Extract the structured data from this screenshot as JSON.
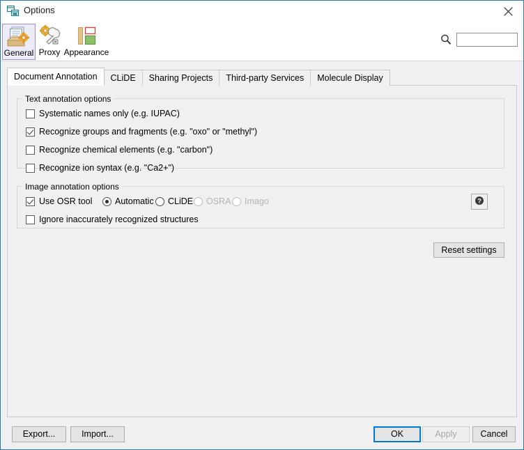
{
  "window": {
    "title": "Options",
    "title_icon": "options-windows-icon",
    "close_icon": "close-icon",
    "accent_border": "#2a7ab0"
  },
  "toolbar": {
    "items": [
      {
        "label": "General",
        "icon": "general-documents-gear-icon",
        "selected": true
      },
      {
        "label": "Proxy",
        "icon": "proxy-gear-wrench-icon",
        "selected": false
      },
      {
        "label": "Appearance",
        "icon": "appearance-layout-icon",
        "selected": false
      }
    ],
    "search": {
      "icon": "search-magnifier-icon",
      "value": "",
      "placeholder": ""
    }
  },
  "tabs": [
    {
      "label": "Document Annotation",
      "active": true
    },
    {
      "label": "CLiDE",
      "active": false
    },
    {
      "label": "Sharing Projects",
      "active": false
    },
    {
      "label": "Third-party Services",
      "active": false
    },
    {
      "label": "Molecule Display",
      "active": false
    }
  ],
  "text_annotation": {
    "title": "Text annotation options",
    "options": [
      {
        "label": "Systematic names only (e.g. IUPAC)",
        "checked": false
      },
      {
        "label": "Recognize groups and fragments (e.g. \"oxo\" or \"methyl\")",
        "checked": true
      },
      {
        "label": "Recognize chemical elements (e.g. \"carbon\")",
        "checked": false
      },
      {
        "label": "Recognize ion syntax (e.g. \"Ca2+\")",
        "checked": false
      }
    ]
  },
  "image_annotation": {
    "title": "Image annotation options",
    "use_osr": {
      "label": "Use OSR tool",
      "checked": true
    },
    "osr_tools": [
      {
        "label": "Automatic",
        "selected": true,
        "enabled": true
      },
      {
        "label": "CLiDE",
        "selected": false,
        "enabled": true
      },
      {
        "label": "OSRA",
        "selected": false,
        "enabled": false
      },
      {
        "label": "Imago",
        "selected": false,
        "enabled": false
      }
    ],
    "ignore_inaccurate": {
      "label": "Ignore inaccurately recognized structures",
      "checked": false
    },
    "help_icon": "help-question-icon"
  },
  "reset_settings": {
    "label": "Reset settings"
  },
  "buttons": {
    "export": {
      "label": "Export...",
      "enabled": true
    },
    "import": {
      "label": "Import...",
      "enabled": true
    },
    "ok": {
      "label": "OK",
      "enabled": true,
      "focused": true,
      "focus_color": "#0078d7"
    },
    "apply": {
      "label": "Apply",
      "enabled": false
    },
    "cancel": {
      "label": "Cancel",
      "enabled": true
    }
  }
}
